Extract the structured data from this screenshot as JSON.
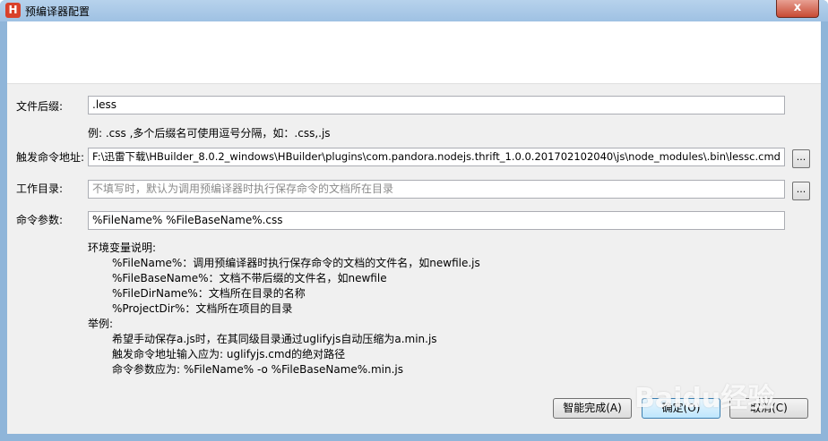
{
  "window": {
    "title": "预编译器配置",
    "icon_letter": "H",
    "close_glyph": "x"
  },
  "form": {
    "suffix_label": "文件后缀:",
    "suffix_value": ".less",
    "suffix_hint": "例: .css ,多个后缀名可使用逗号分隔，如：.css,.js",
    "command_label": "触发命令地址:",
    "command_value": "F:\\迅雷下载\\HBuilder_8.0.2_windows\\HBuilder\\plugins\\com.pandora.nodejs.thrift_1.0.0.201702102040\\js\\node_modules\\.bin\\lessc.cmd",
    "workdir_label": "工作目录:",
    "workdir_placeholder": "不填写时，默认为调用预编译器时执行保存命令的文档所在目录",
    "params_label": "命令参数:",
    "params_value": "%FileName% %FileBaseName%.css",
    "browse_label": "..."
  },
  "help": {
    "env_title": "环境变量说明:",
    "env_items": [
      "%FileName%：调用预编译器时执行保存命令的文档的文件名，如newfile.js",
      "%FileBaseName%：文档不带后缀的文件名，如newfile",
      "%FileDirName%：文档所在目录的名称",
      "%ProjectDir%：文档所在项目的目录"
    ],
    "example_title": "举例:",
    "example_items": [
      "希望手动保存a.js时，在其同级目录通过uglifyjs自动压缩为a.min.js",
      "触发命令地址输入应为: uglifyjs.cmd的绝对路径",
      "命令参数应为: %FileName% -o %FileBaseName%.min.js"
    ]
  },
  "buttons": {
    "autocomplete": "智能完成(A)",
    "ok": "确定(O)",
    "cancel": "取消(C)"
  },
  "watermark": "Baidu经验"
}
